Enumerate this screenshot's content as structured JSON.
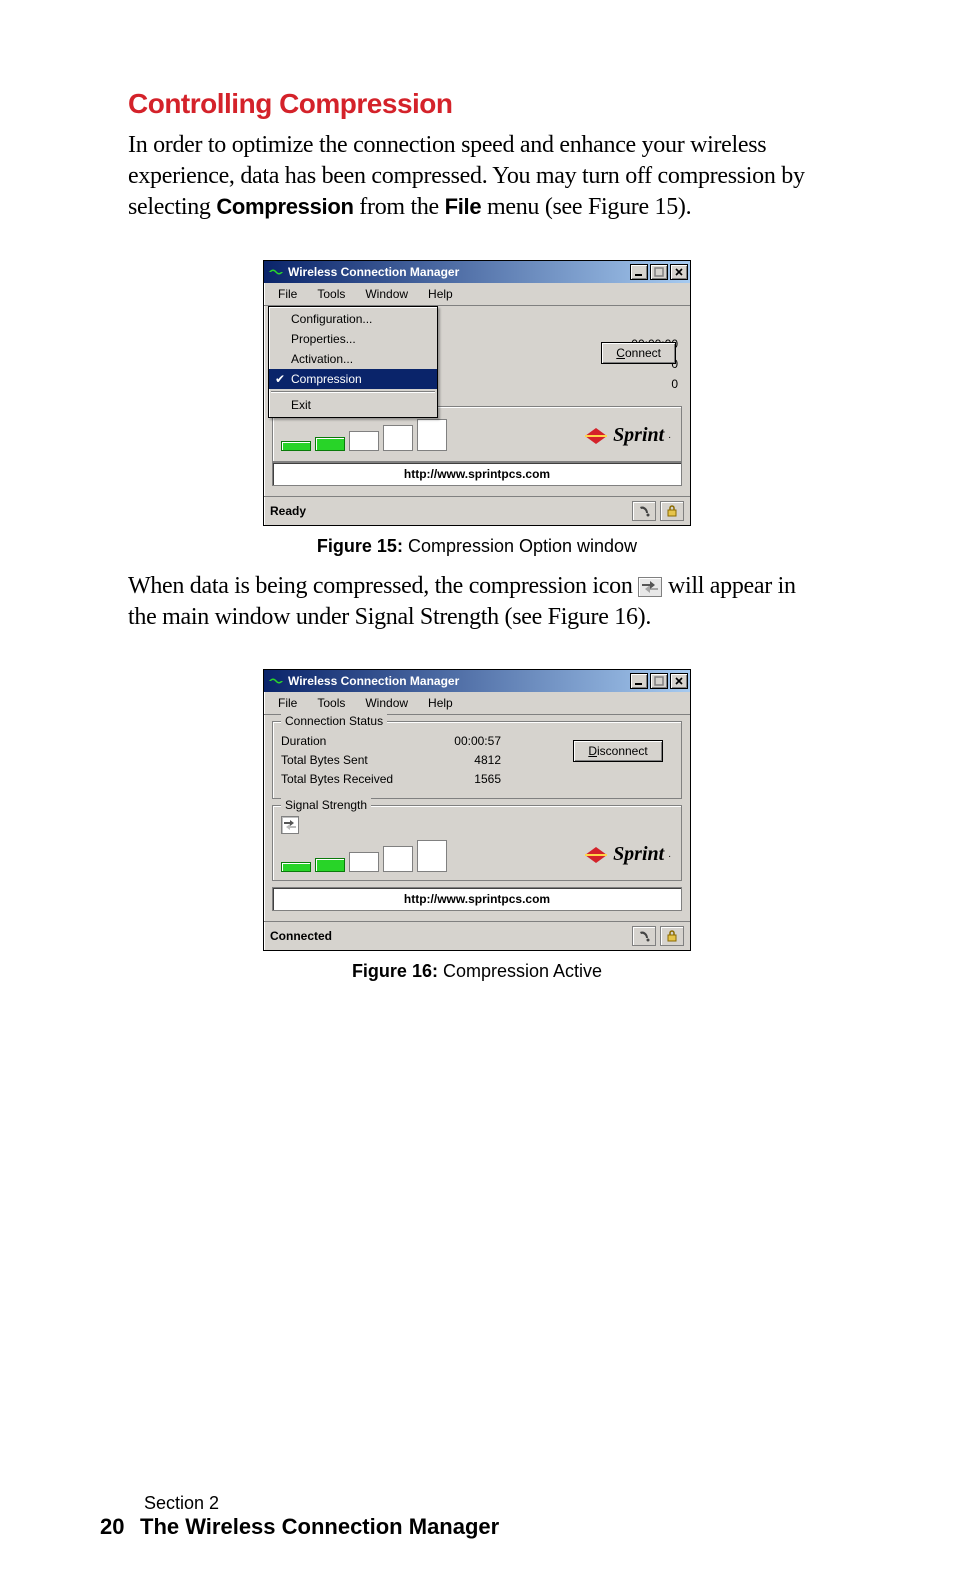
{
  "heading": "Controlling Compression",
  "para1_a": "In order to optimize the connection speed and enhance your wireless experience, data has been compressed. You may turn off compression by selecting ",
  "para1_b1": "Compression",
  "para1_c": " from the ",
  "para1_b2": "File",
  "para1_d": " menu (see Figure 15).",
  "para2_a": "When data is being compressed, the compression icon ",
  "para2_b": " will appear in the main window under Signal Strength (see Figure 16).",
  "fig15_caption_b": "Figure 15:",
  "fig15_caption_t": " Compression Option window",
  "fig16_caption_b": "Figure 16:",
  "fig16_caption_t": " Compression Active",
  "footer_section": "Section 2",
  "footer_pagenum": "20",
  "footer_title": "The Wireless Connection Manager",
  "app": {
    "title": "Wireless Connection Manager",
    "menu": {
      "file": "File",
      "tools": "Tools",
      "window": "Window",
      "help": "Help"
    },
    "file_menu": {
      "configuration": "Configuration...",
      "properties": "Properties...",
      "activation": "Activation...",
      "compression": "Compression",
      "exit": "Exit"
    },
    "group_conn": "Connection Status",
    "group_sig": "Signal Strength",
    "labels": {
      "duration": "Duration",
      "sent": "Total Bytes Sent",
      "recv": "Total Bytes Received"
    },
    "url": "http://www.sprintpcs.com",
    "brand": "Sprint",
    "btn_connect": "Connect",
    "btn_disconnect": "Disconnect"
  },
  "fig15": {
    "duration": "00:00:00",
    "sent": "0",
    "recv": "0",
    "status": "Ready",
    "sig_on": 2,
    "sig_heights": [
      10,
      14,
      20,
      26,
      32
    ]
  },
  "fig16": {
    "duration": "00:00:57",
    "sent": "4812",
    "recv": "1565",
    "status": "Connected",
    "sig_on": 2,
    "sig_heights": [
      10,
      14,
      20,
      26,
      32
    ]
  }
}
